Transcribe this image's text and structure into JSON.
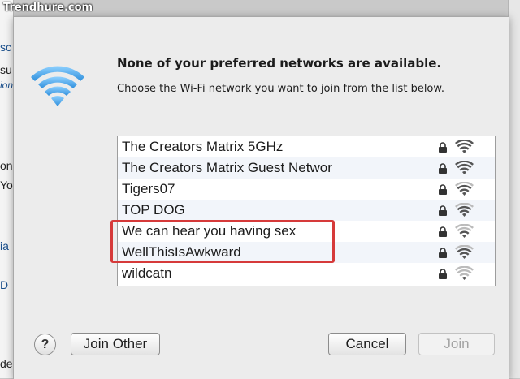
{
  "watermark": "Trendhure.com",
  "background": {
    "fragments": [
      "sc",
      "su",
      "ion",
      "on",
      "Yo",
      "ia",
      "D",
      "de"
    ]
  },
  "dialog": {
    "icon": "wifi-icon",
    "heading": "None of your preferred networks are available.",
    "subheading": "Choose the Wi-Fi network you want to join from the list below.",
    "networks": [
      {
        "name": "The Creators Matrix 5GHz",
        "secured": true
      },
      {
        "name": "The Creators Matrix Guest Networ",
        "secured": true
      },
      {
        "name": "Tigers07",
        "secured": true
      },
      {
        "name": "TOP DOG",
        "secured": true
      },
      {
        "name": "We can hear you having sex",
        "secured": true
      },
      {
        "name": "WellThisIsAwkward",
        "secured": true
      },
      {
        "name": "wildcatn",
        "secured": true
      }
    ],
    "help_label": "?",
    "join_other_label": "Join Other",
    "cancel_label": "Cancel",
    "join_label": "Join"
  },
  "colors": {
    "wifi_blue": "#3aa0e6",
    "highlight_red": "#d63a3a",
    "dialog_bg": "#ececec"
  }
}
